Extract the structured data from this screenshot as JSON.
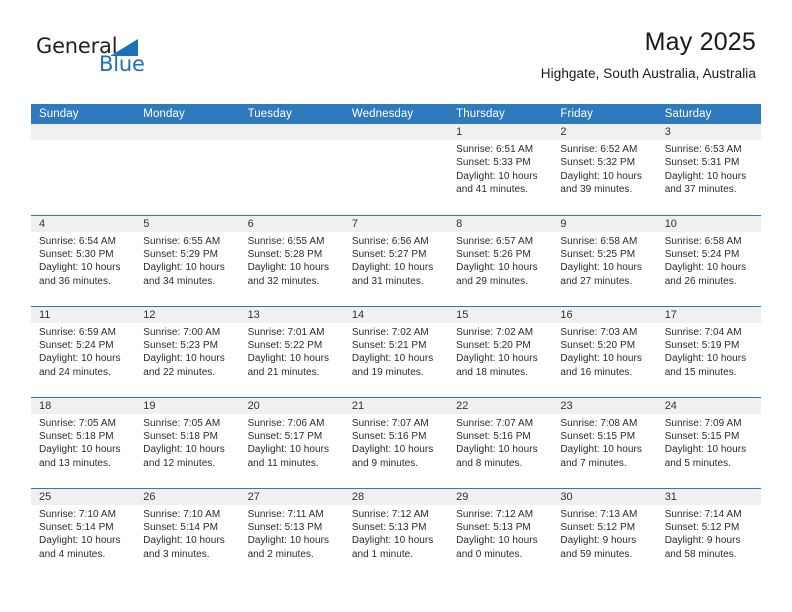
{
  "logo": {
    "word_top": "General",
    "word_bottom": "Blue",
    "triangle_color": "#1b72b8"
  },
  "header": {
    "title": "May 2025",
    "subtitle": "Highgate, South Australia, Australia"
  },
  "theme": {
    "header_blue": "#2f79bd",
    "daynum_gray": "#f0f0f0",
    "text": "#2b2b2b"
  },
  "weekday_headers": [
    "Sunday",
    "Monday",
    "Tuesday",
    "Wednesday",
    "Thursday",
    "Friday",
    "Saturday"
  ],
  "labels": {
    "sunrise_prefix": "Sunrise:",
    "sunset_prefix": "Sunset:",
    "daylight_prefix": "Daylight:"
  },
  "weeks": [
    [
      {
        "day": "",
        "sunrise": "",
        "sunset": "",
        "daylight_line1": "",
        "daylight_line2": ""
      },
      {
        "day": "",
        "sunrise": "",
        "sunset": "",
        "daylight_line1": "",
        "daylight_line2": ""
      },
      {
        "day": "",
        "sunrise": "",
        "sunset": "",
        "daylight_line1": "",
        "daylight_line2": ""
      },
      {
        "day": "",
        "sunrise": "",
        "sunset": "",
        "daylight_line1": "",
        "daylight_line2": ""
      },
      {
        "day": "1",
        "sunrise": "Sunrise: 6:51 AM",
        "sunset": "Sunset: 5:33 PM",
        "daylight_line1": "Daylight: 10 hours",
        "daylight_line2": "and 41 minutes."
      },
      {
        "day": "2",
        "sunrise": "Sunrise: 6:52 AM",
        "sunset": "Sunset: 5:32 PM",
        "daylight_line1": "Daylight: 10 hours",
        "daylight_line2": "and 39 minutes."
      },
      {
        "day": "3",
        "sunrise": "Sunrise: 6:53 AM",
        "sunset": "Sunset: 5:31 PM",
        "daylight_line1": "Daylight: 10 hours",
        "daylight_line2": "and 37 minutes."
      }
    ],
    [
      {
        "day": "4",
        "sunrise": "Sunrise: 6:54 AM",
        "sunset": "Sunset: 5:30 PM",
        "daylight_line1": "Daylight: 10 hours",
        "daylight_line2": "and 36 minutes."
      },
      {
        "day": "5",
        "sunrise": "Sunrise: 6:55 AM",
        "sunset": "Sunset: 5:29 PM",
        "daylight_line1": "Daylight: 10 hours",
        "daylight_line2": "and 34 minutes."
      },
      {
        "day": "6",
        "sunrise": "Sunrise: 6:55 AM",
        "sunset": "Sunset: 5:28 PM",
        "daylight_line1": "Daylight: 10 hours",
        "daylight_line2": "and 32 minutes."
      },
      {
        "day": "7",
        "sunrise": "Sunrise: 6:56 AM",
        "sunset": "Sunset: 5:27 PM",
        "daylight_line1": "Daylight: 10 hours",
        "daylight_line2": "and 31 minutes."
      },
      {
        "day": "8",
        "sunrise": "Sunrise: 6:57 AM",
        "sunset": "Sunset: 5:26 PM",
        "daylight_line1": "Daylight: 10 hours",
        "daylight_line2": "and 29 minutes."
      },
      {
        "day": "9",
        "sunrise": "Sunrise: 6:58 AM",
        "sunset": "Sunset: 5:25 PM",
        "daylight_line1": "Daylight: 10 hours",
        "daylight_line2": "and 27 minutes."
      },
      {
        "day": "10",
        "sunrise": "Sunrise: 6:58 AM",
        "sunset": "Sunset: 5:24 PM",
        "daylight_line1": "Daylight: 10 hours",
        "daylight_line2": "and 26 minutes."
      }
    ],
    [
      {
        "day": "11",
        "sunrise": "Sunrise: 6:59 AM",
        "sunset": "Sunset: 5:24 PM",
        "daylight_line1": "Daylight: 10 hours",
        "daylight_line2": "and 24 minutes."
      },
      {
        "day": "12",
        "sunrise": "Sunrise: 7:00 AM",
        "sunset": "Sunset: 5:23 PM",
        "daylight_line1": "Daylight: 10 hours",
        "daylight_line2": "and 22 minutes."
      },
      {
        "day": "13",
        "sunrise": "Sunrise: 7:01 AM",
        "sunset": "Sunset: 5:22 PM",
        "daylight_line1": "Daylight: 10 hours",
        "daylight_line2": "and 21 minutes."
      },
      {
        "day": "14",
        "sunrise": "Sunrise: 7:02 AM",
        "sunset": "Sunset: 5:21 PM",
        "daylight_line1": "Daylight: 10 hours",
        "daylight_line2": "and 19 minutes."
      },
      {
        "day": "15",
        "sunrise": "Sunrise: 7:02 AM",
        "sunset": "Sunset: 5:20 PM",
        "daylight_line1": "Daylight: 10 hours",
        "daylight_line2": "and 18 minutes."
      },
      {
        "day": "16",
        "sunrise": "Sunrise: 7:03 AM",
        "sunset": "Sunset: 5:20 PM",
        "daylight_line1": "Daylight: 10 hours",
        "daylight_line2": "and 16 minutes."
      },
      {
        "day": "17",
        "sunrise": "Sunrise: 7:04 AM",
        "sunset": "Sunset: 5:19 PM",
        "daylight_line1": "Daylight: 10 hours",
        "daylight_line2": "and 15 minutes."
      }
    ],
    [
      {
        "day": "18",
        "sunrise": "Sunrise: 7:05 AM",
        "sunset": "Sunset: 5:18 PM",
        "daylight_line1": "Daylight: 10 hours",
        "daylight_line2": "and 13 minutes."
      },
      {
        "day": "19",
        "sunrise": "Sunrise: 7:05 AM",
        "sunset": "Sunset: 5:18 PM",
        "daylight_line1": "Daylight: 10 hours",
        "daylight_line2": "and 12 minutes."
      },
      {
        "day": "20",
        "sunrise": "Sunrise: 7:06 AM",
        "sunset": "Sunset: 5:17 PM",
        "daylight_line1": "Daylight: 10 hours",
        "daylight_line2": "and 11 minutes."
      },
      {
        "day": "21",
        "sunrise": "Sunrise: 7:07 AM",
        "sunset": "Sunset: 5:16 PM",
        "daylight_line1": "Daylight: 10 hours",
        "daylight_line2": "and 9 minutes."
      },
      {
        "day": "22",
        "sunrise": "Sunrise: 7:07 AM",
        "sunset": "Sunset: 5:16 PM",
        "daylight_line1": "Daylight: 10 hours",
        "daylight_line2": "and 8 minutes."
      },
      {
        "day": "23",
        "sunrise": "Sunrise: 7:08 AM",
        "sunset": "Sunset: 5:15 PM",
        "daylight_line1": "Daylight: 10 hours",
        "daylight_line2": "and 7 minutes."
      },
      {
        "day": "24",
        "sunrise": "Sunrise: 7:09 AM",
        "sunset": "Sunset: 5:15 PM",
        "daylight_line1": "Daylight: 10 hours",
        "daylight_line2": "and 5 minutes."
      }
    ],
    [
      {
        "day": "25",
        "sunrise": "Sunrise: 7:10 AM",
        "sunset": "Sunset: 5:14 PM",
        "daylight_line1": "Daylight: 10 hours",
        "daylight_line2": "and 4 minutes."
      },
      {
        "day": "26",
        "sunrise": "Sunrise: 7:10 AM",
        "sunset": "Sunset: 5:14 PM",
        "daylight_line1": "Daylight: 10 hours",
        "daylight_line2": "and 3 minutes."
      },
      {
        "day": "27",
        "sunrise": "Sunrise: 7:11 AM",
        "sunset": "Sunset: 5:13 PM",
        "daylight_line1": "Daylight: 10 hours",
        "daylight_line2": "and 2 minutes."
      },
      {
        "day": "28",
        "sunrise": "Sunrise: 7:12 AM",
        "sunset": "Sunset: 5:13 PM",
        "daylight_line1": "Daylight: 10 hours",
        "daylight_line2": "and 1 minute."
      },
      {
        "day": "29",
        "sunrise": "Sunrise: 7:12 AM",
        "sunset": "Sunset: 5:13 PM",
        "daylight_line1": "Daylight: 10 hours",
        "daylight_line2": "and 0 minutes."
      },
      {
        "day": "30",
        "sunrise": "Sunrise: 7:13 AM",
        "sunset": "Sunset: 5:12 PM",
        "daylight_line1": "Daylight: 9 hours",
        "daylight_line2": "and 59 minutes."
      },
      {
        "day": "31",
        "sunrise": "Sunrise: 7:14 AM",
        "sunset": "Sunset: 5:12 PM",
        "daylight_line1": "Daylight: 9 hours",
        "daylight_line2": "and 58 minutes."
      }
    ]
  ]
}
